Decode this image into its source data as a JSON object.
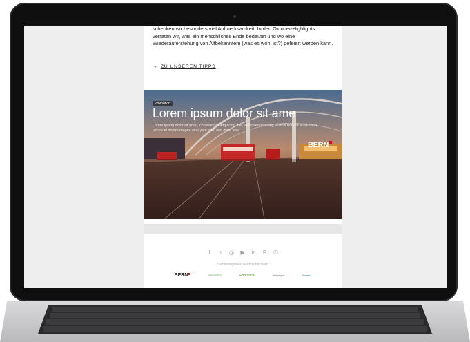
{
  "email": {
    "intro_text": "schenken wir besonders viel Aufmerksamkeit. In den Oktober-Highlights verraten wir, was ein menschliches Ende bedeutet und wo eine Wiederauferstehung von Altbekanntem (was es wohl ist?) gefeiert werden kann.",
    "cta": {
      "arrow": "→",
      "label": "ZU UNSEREN TIPPS"
    },
    "promo": {
      "badge": "Promotion",
      "title": "Lorem ipsum dolor sit ame",
      "body": "Lorem ipsum dolor sit amet, consetetur sadipscing elitr, sed diam nonumy eirmod tempor invidunt ut labore et dolore magna aliquyam erat, sed diam volu",
      "logo": "BERN"
    },
    "footer": {
      "social_icons": [
        "facebook-icon",
        "tiktok-icon",
        "instagram-icon",
        "youtube-icon",
        "linkedin-icon",
        "pinterest-icon",
        "whatsapp-icon"
      ],
      "social_glyphs": [
        "f",
        "♪",
        "◎",
        "▶",
        "in",
        "P",
        "✆"
      ],
      "note": "Tochterregionen Destination Bern",
      "partners": {
        "bern": "BERN",
        "gantrisch": "GANTRISCH",
        "emmental": "Emmental",
        "oberaargau": "oberaargau",
        "seeland": "Seeland"
      }
    }
  },
  "colors": {
    "accent_red": "#e30613",
    "screen_bg": "#eeeeee"
  }
}
